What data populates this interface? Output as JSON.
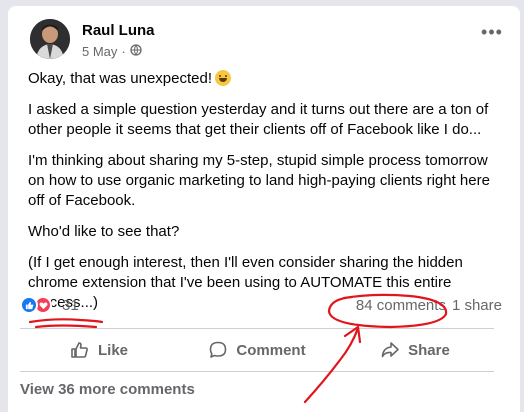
{
  "post": {
    "author": "Raul Luna",
    "date": "5 May",
    "privacy_icon": "globe-icon",
    "paragraphs": [
      "Okay, that was unexpected!",
      "I asked a simple question yesterday and it turns out there are a ton of other people it seems that get their clients off of Facebook like I do...",
      "I'm thinking about sharing my 5-step, stupid simple process tomorrow on how to use organic marketing to land high-paying clients right here off of Facebook.",
      "Who'd like to see that?",
      "(If I get enough interest, then I'll even consider sharing the hidden chrome extension that I've been using to AUTOMATE this entire process...)"
    ],
    "reaction_count": "31",
    "comments": "84 comments",
    "shares": "1 share"
  },
  "actions": {
    "like": "Like",
    "comment": "Comment",
    "share": "Share"
  },
  "view_more": "View 36 more comments",
  "colors": {
    "annotation": "#e0161c",
    "like_blue": "#1877f2",
    "love_red": "#f33e58"
  }
}
